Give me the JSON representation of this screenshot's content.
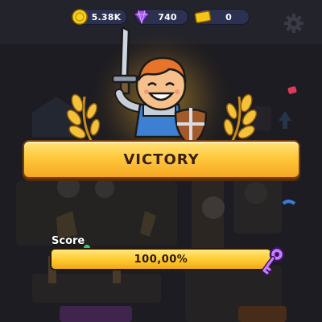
{
  "currencies": {
    "coins": {
      "value": "5.38K",
      "icon": "coin-icon",
      "color": "#f7d21e"
    },
    "gems": {
      "value": "740",
      "icon": "gem-icon",
      "color": "#a855f7"
    },
    "tickets": {
      "value": "0",
      "icon": "ticket-icon",
      "color": "#f5c518"
    }
  },
  "settings": {
    "icon": "gear-icon"
  },
  "hero": {
    "icon": "knight-hero-icon",
    "weapon": "sword-icon",
    "shield": "shield-icon"
  },
  "banner": {
    "title": "VICTORY",
    "color": "#ffc93c"
  },
  "score": {
    "label": "Score",
    "value_text": "100,00%",
    "progress_fraction": 1.0,
    "reward_icon": "key-icon"
  }
}
